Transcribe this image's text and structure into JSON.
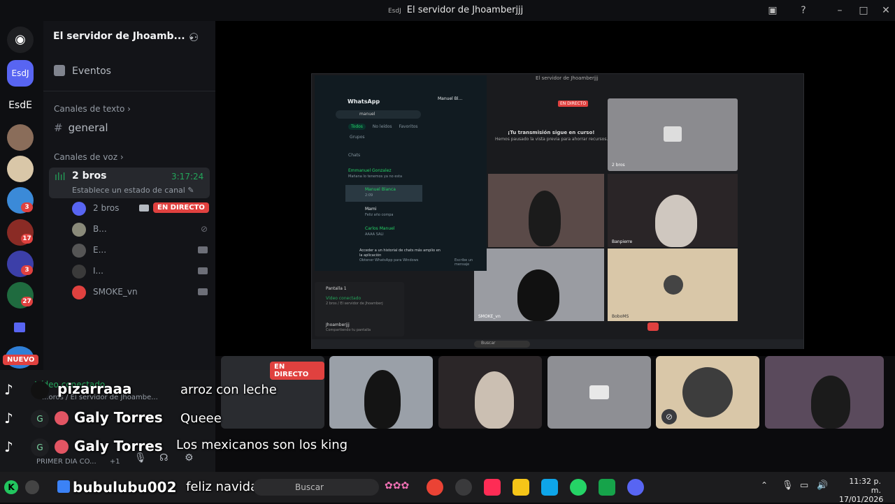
{
  "window": {
    "title": "El servidor de Jhoamberjjj",
    "app_tag": "EsdJ"
  },
  "rail": {
    "servers": [
      {
        "label": "EsdJ",
        "color": "#5865f2"
      },
      {
        "label": "EsdE",
        "color": "#131418"
      }
    ],
    "badges": [
      "3",
      "17",
      "3",
      "27"
    ],
    "new_label": "NUEVO"
  },
  "sidebar": {
    "server_name": "El servidor de Jhoamb...",
    "events_label": "Eventos",
    "text_category": "Canales de texto",
    "text_channels": [
      "general"
    ],
    "voice_category": "Canales de voz",
    "voice_channel": {
      "name": "2 bros",
      "timer": "3:17:24",
      "status": "Establece un estado de canal"
    },
    "voice_users": [
      {
        "name": "2 bros",
        "live": "EN DIRECTO"
      },
      {
        "name": "B..."
      },
      {
        "name": "E..."
      },
      {
        "name": "I..."
      },
      {
        "name": "SMOKE_vn"
      }
    ],
    "footer": {
      "video_connected": "Vídeo conectado",
      "path": "...oros / El servidor de Jhoambe...",
      "first_day": "PRIMER DIA CO...",
      "plus": "+1"
    }
  },
  "stage": {
    "whatsapp": {
      "title": "WhatsApp",
      "search": "manuel",
      "filters": [
        "Todos",
        "No leídos",
        "Favoritos",
        "Grupos"
      ],
      "chats_label": "Chats",
      "chats": [
        {
          "name": "Emmanuel Gonzalez",
          "preview": "Mañana lo tenemos ya no esta"
        },
        {
          "name": "Manuel Blanca",
          "preview": "2:09"
        },
        {
          "name": "Mami",
          "preview": "Feliz año compa"
        },
        {
          "name": "Carlos Manuel",
          "preview": "AAAA SALI"
        }
      ],
      "promo": "Acceder a un historial de chats más amplio en la aplicación",
      "promo_sub": "Obtener WhatsApp para Windows",
      "contact": "Manuel Bl...",
      "compose": "Escribe un mensaje"
    },
    "inner_title": "El servidor de Jhoamberjjj",
    "inner_live": "EN DIRECTO",
    "inner_notice_title": "¡Tu transmisión sigue en curso!",
    "inner_notice_body": "Hemos pausado la vista previa para ahorrar recursos.",
    "inner_tile_label": "2 bros",
    "inner_names": [
      "Banpierre",
      "SMOKE_vn",
      "BoboMS"
    ],
    "screen_panel": {
      "title": "Pantalla 1",
      "status": "Vídeo conectado",
      "sub": "2 bros / El servidor de Jhoamberj",
      "user": "Jhoamberjjj",
      "user_sub": "Compartiendo tu pantalla"
    },
    "taskbar_search": "Buscar"
  },
  "tiles": {
    "live_label": "EN DIRECTO"
  },
  "chat_overlay": [
    {
      "user": "pizarraaa",
      "message": "arroz con leche",
      "avatar": ""
    },
    {
      "user": "Galy Torres",
      "message": "Queee",
      "avatar": "G"
    },
    {
      "user": "Galy Torres",
      "message": "Los mexicanos son los king",
      "avatar": "G"
    },
    {
      "user": "bubulubu002",
      "message": "feliz navidad bro",
      "avatar": ""
    }
  ],
  "taskbar": {
    "search_placeholder": "Buscar",
    "time": "11:32 p. m.",
    "date": "17/01/2026"
  }
}
